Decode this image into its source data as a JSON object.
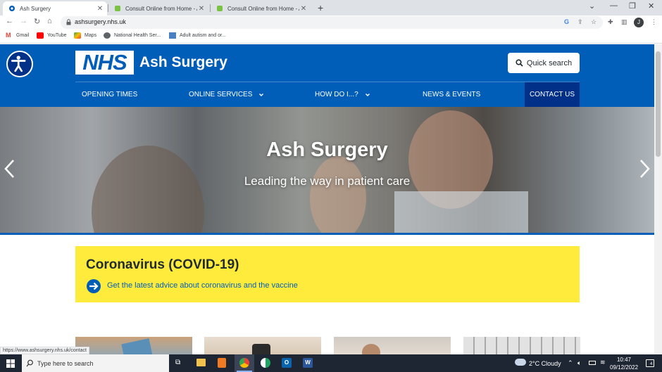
{
  "browser": {
    "tabs": [
      {
        "title": "Ash Surgery",
        "active": true
      },
      {
        "title": "Consult Online from Home - Ash",
        "active": false
      },
      {
        "title": "Consult Online from Home - Ash",
        "active": false
      }
    ],
    "url": "ashsurgery.nhs.uk",
    "bookmarks": [
      "Gmail",
      "YouTube",
      "Maps",
      "National Health Ser...",
      "Adult autism and or..."
    ],
    "avatar_letter": "J",
    "status_url": "https://www.ashsurgery.nhs.uk/contact"
  },
  "site": {
    "logo_text": "NHS",
    "name": "Ash Surgery",
    "quick_search": "Quick search",
    "nav": [
      {
        "label": "OPENING TIMES",
        "has_dropdown": false
      },
      {
        "label": "ONLINE SERVICES",
        "has_dropdown": true
      },
      {
        "label": "HOW DO I...?",
        "has_dropdown": true
      },
      {
        "label": "NEWS & EVENTS",
        "has_dropdown": false
      },
      {
        "label": "CONTACT US",
        "has_dropdown": false,
        "current": true
      }
    ],
    "hero": {
      "title": "Ash Surgery",
      "subtitle": "Leading the way in patient care"
    },
    "covid": {
      "title": "Coronavirus (COVID-19)",
      "link": "Get the latest advice about coronavirus and the vaccine"
    }
  },
  "taskbar": {
    "search_placeholder": "Type here to search",
    "weather": "2°C  Cloudy",
    "time": "10:47",
    "date": "09/12/2022",
    "notifications": "4"
  },
  "colors": {
    "nhs_blue": "#005eb8",
    "nhs_dark_blue": "#003087",
    "covid_yellow": "#ffeb3b"
  }
}
